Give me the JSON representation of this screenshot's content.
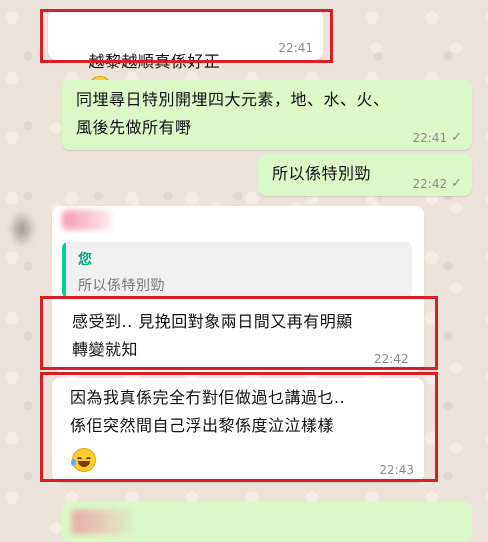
{
  "messages": [
    {
      "id": "m1",
      "dir": "in",
      "text": "越黎越順真係好正",
      "emoji": "joy",
      "time": "22:41"
    },
    {
      "id": "m2",
      "dir": "out",
      "text": "同埋尋日特別開埋四大元素，地、水、火、\n風後先做所有嘢",
      "time": "22:41",
      "tick": "✓"
    },
    {
      "id": "m3",
      "dir": "out",
      "text": "所以係特別勁",
      "time": "22:42",
      "tick": "✓"
    },
    {
      "id": "m4",
      "dir": "in",
      "text": "感受到.. 見挽回對象兩日間又再有明顯\n轉變就知",
      "time": "22:42",
      "quote": {
        "name": "您",
        "text": "所以係特別勁"
      }
    },
    {
      "id": "m5",
      "dir": "in",
      "text": "因為我真係完全冇對佢做過乜講過乜..\n係佢突然間自己浮出黎係度泣泣樣樣",
      "emoji": "joy",
      "time": "22:43"
    }
  ]
}
